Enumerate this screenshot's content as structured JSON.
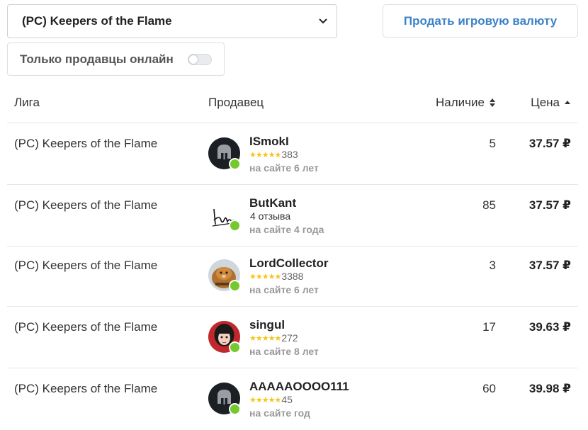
{
  "filter": {
    "league_selected": "(PC) Keepers of the Flame",
    "online_only_label": "Только продавцы онлайн",
    "online_only_on": false
  },
  "sell_button_label": "Продать игровую валюту",
  "colors": {
    "accent": "#3b82c9",
    "online": "#73c92d",
    "stars": "#f5c518"
  },
  "table": {
    "headers": {
      "league": "Лига",
      "seller": "Продавец",
      "stock": "Наличие",
      "price": "Цена"
    },
    "rows": [
      {
        "league": "(PC) Keepers of the Flame",
        "seller": "ISmokI",
        "rating_stars": "★★★★★",
        "rating_count": "383",
        "since": "на сайте 6 лет",
        "stock": "5",
        "price": "37.57 ₽",
        "avatar": "helmet-icon"
      },
      {
        "league": "(PC) Keepers of the Flame",
        "seller": "ButKant",
        "rating_stars": "",
        "rating_count": "4 отзыва",
        "since": "на сайте 4 года",
        "stock": "85",
        "price": "37.57 ₽",
        "avatar": "signature-icon"
      },
      {
        "league": "(PC) Keepers of the Flame",
        "seller": "LordCollector",
        "rating_stars": "★★★★★",
        "rating_count": "3388",
        "since": "на сайте 6 лет",
        "stock": "3",
        "price": "37.57 ₽",
        "avatar": "cat-photo"
      },
      {
        "league": "(PC) Keepers of the Flame",
        "seller": "singul",
        "rating_stars": "★★★★★",
        "rating_count": "272",
        "since": "на сайте 8 лет",
        "stock": "17",
        "price": "39.63 ₽",
        "avatar": "anime-girl-photo"
      },
      {
        "league": "(PC) Keepers of the Flame",
        "seller": "AAAAAOOOO111",
        "rating_stars": "★★★★★",
        "rating_count": "45",
        "since": "на сайте год",
        "stock": "60",
        "price": "39.98 ₽",
        "avatar": "helmet-icon"
      }
    ]
  }
}
